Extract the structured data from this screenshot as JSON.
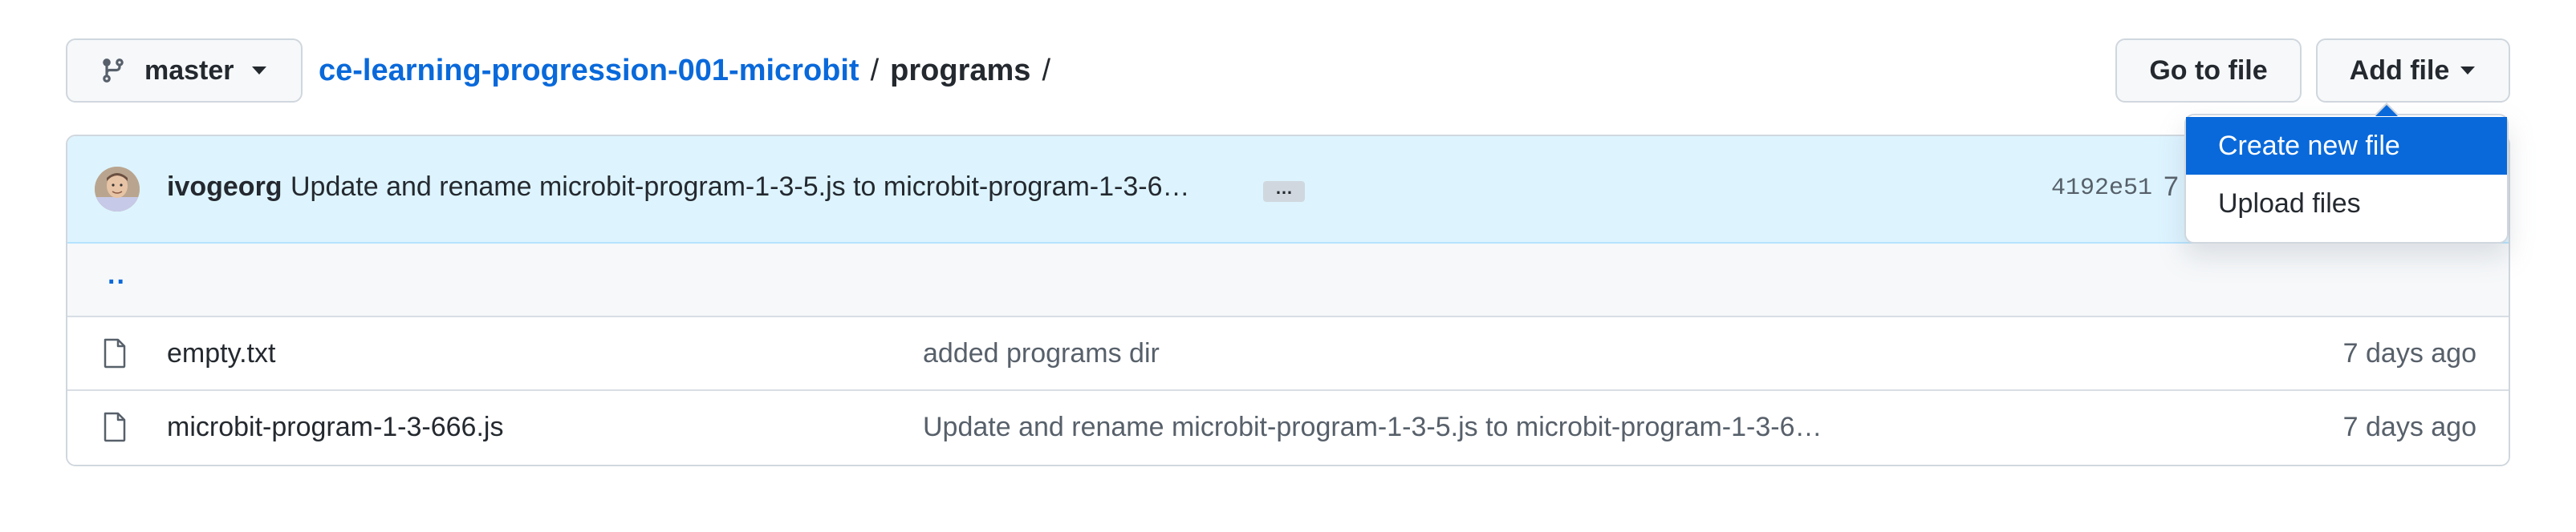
{
  "branch": {
    "label": "master",
    "icon": "git-branch-icon"
  },
  "breadcrumb": {
    "repo": "ce-learning-progression-001-microbit",
    "separator": "/",
    "folder": "programs",
    "trailing": "/"
  },
  "toolbar": {
    "goto_file_label": "Go to file",
    "add_file_label": "Add file"
  },
  "add_file_menu": {
    "items": [
      {
        "label": "Create new file",
        "active": true
      },
      {
        "label": "Upload files",
        "active": false
      }
    ]
  },
  "latest_commit": {
    "author": "ivogeorg",
    "message": "Update and rename microbit-program-1-3-5.js to microbit-program-1-3-6…",
    "ellipsis": "…",
    "sha": "4192e51",
    "time_prefix": "7"
  },
  "parent_dir_label": "..",
  "files": [
    {
      "name": "empty.txt",
      "icon": "file-icon",
      "commit_message": "added programs dir",
      "age": "7 days ago"
    },
    {
      "name": "microbit-program-1-3-666.js",
      "icon": "file-icon",
      "commit_message": "Update and rename microbit-program-1-3-5.js to microbit-program-1-3-6…",
      "age": "7 days ago"
    }
  ],
  "colors": {
    "link": "#0969da",
    "commit_bar_bg": "#ddf4ff",
    "border": "#d0d7de",
    "muted_text": "#57606a",
    "menu_active_bg": "#0969da"
  }
}
